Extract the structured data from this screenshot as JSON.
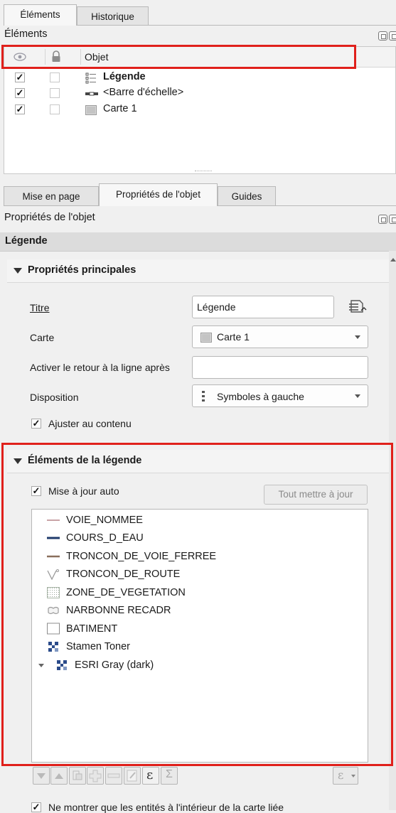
{
  "top_tabs": [
    {
      "label": "Éléments",
      "active": true
    },
    {
      "label": "Historique",
      "active": false
    }
  ],
  "items_panel": {
    "title": "Éléments",
    "columns": {
      "visible_icon": "eye-icon",
      "lock_icon": "lock-icon",
      "object": "Objet"
    },
    "rows": [
      {
        "label": "Légende",
        "visible": true,
        "locked": false,
        "icon": "legend-icon",
        "bold": true
      },
      {
        "label": "<Barre d'échelle>",
        "visible": true,
        "locked": false,
        "icon": "scale-bar-icon",
        "bold": false
      },
      {
        "label": "Carte 1",
        "visible": true,
        "locked": false,
        "icon": "map-icon",
        "bold": false
      }
    ]
  },
  "bottom_tabs": [
    {
      "label": "Mise en page",
      "active": false
    },
    {
      "label": "Propriétés de l'objet",
      "active": true
    },
    {
      "label": "Guides",
      "active": false
    }
  ],
  "props": {
    "panel_title": "Propriétés de l'objet",
    "object_name": "Légende",
    "main_section": {
      "title": "Propriétés principales",
      "title_label": "Titre",
      "title_value": "Légende",
      "map_label": "Carte",
      "map_value": "Carte 1",
      "wrap_label": "Activer le retour à la ligne après",
      "wrap_value": "",
      "layout_label": "Disposition",
      "layout_value": "Symboles à gauche",
      "resize_label": "Ajuster au contenu",
      "resize_checked": true
    },
    "legend_items": {
      "title": "Éléments de la légende",
      "auto_update_label": "Mise à jour auto",
      "auto_update_checked": true,
      "update_all_label": "Tout mettre à jour",
      "items": [
        {
          "label": "VOIE_NOMMEE",
          "symbol": "line",
          "color": "#c9a3a6"
        },
        {
          "label": "COURS_D_EAU",
          "symbol": "line",
          "color": "#1f3a6b"
        },
        {
          "label": "TRONCON_DE_VOIE_FERREE",
          "symbol": "line",
          "color": "#8a6f5c"
        },
        {
          "label": "TRONCON_DE_ROUTE",
          "symbol": "route-icon",
          "color": "#9a9a9a"
        },
        {
          "label": "ZONE_DE_VEGETATION",
          "symbol": "dotted-fill",
          "color": "#aab7a8"
        },
        {
          "label": "NARBONNE RECADR",
          "symbol": "polygon-outline",
          "color": "#9a9a9a"
        },
        {
          "label": "BATIMENT",
          "symbol": "square-outline",
          "color": "#8c8c8c"
        },
        {
          "label": "Stamen Toner",
          "symbol": "raster-icon",
          "color": "#2b4b8a"
        },
        {
          "label": "ESRI Gray (dark)",
          "symbol": "raster-icon",
          "color": "#2b4b8a",
          "expandable": true
        }
      ],
      "toolbar": [
        "move-down-icon",
        "move-up-icon",
        "add-group-icon",
        "add-item-icon",
        "remove-item-icon",
        "edit-icon",
        "expression-icon",
        "sum-icon",
        "filter-expression-icon"
      ],
      "expression_symbol": "ε",
      "sum_symbol": "Σ"
    },
    "only_inside_map_label": "Ne montrer que les entités à l'intérieur de la carte liée"
  },
  "colors": {
    "highlight": "#e0201b",
    "section_bg": "#dcdcdc"
  }
}
